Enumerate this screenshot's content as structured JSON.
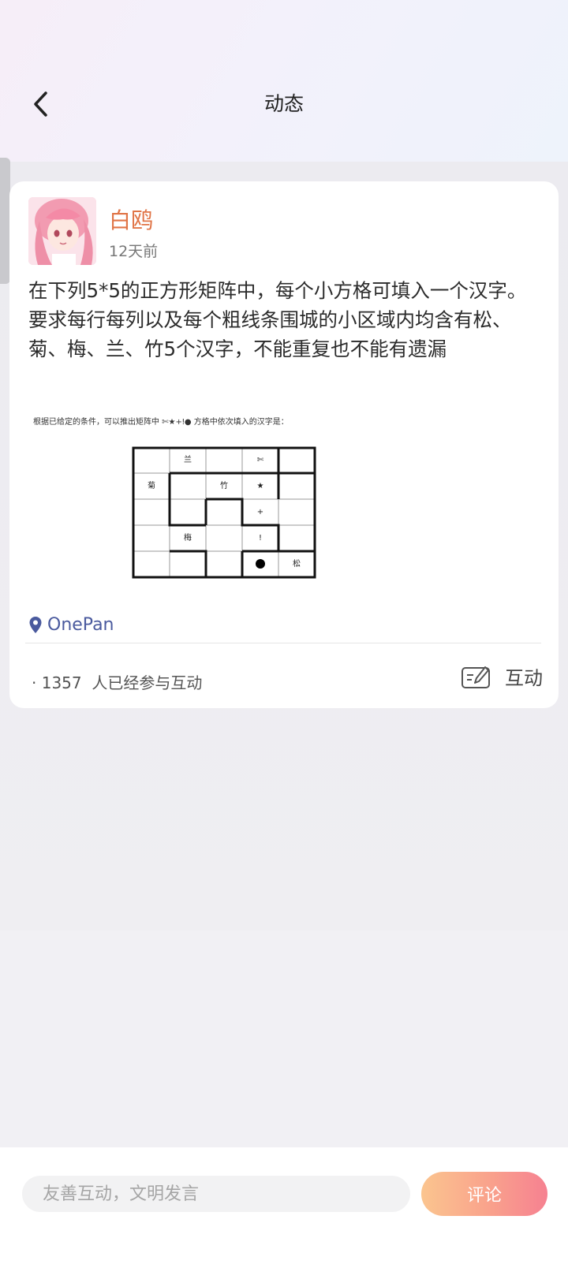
{
  "header": {
    "title": "动态"
  },
  "post": {
    "username": "白鸥",
    "time": "12天前",
    "text": "在下列5*5的正方形矩阵中，每个小方格可填入一个汉字。要求每行每列以及每个粗线条围城的小区域内均含有松、菊、梅、兰、竹5个汉字，不能重复也不能有遗漏",
    "image": {
      "caption": "根据已给定的条件，可以推出矩阵中",
      "caption_suffix": "方格中依次填入的汉字是：",
      "grid": [
        [
          "",
          "兰",
          "",
          "✄",
          ""
        ],
        [
          "菊",
          "",
          "竹",
          "★",
          ""
        ],
        [
          "",
          "",
          "",
          "+",
          ""
        ],
        [
          "",
          "梅",
          "",
          "ǃ",
          ""
        ],
        [
          "",
          "",
          "",
          "●",
          "松"
        ]
      ]
    },
    "location": "OnePan",
    "participants_count": "1357",
    "participants_label": "人已经参与互动",
    "interact_label": "互动"
  },
  "bottom": {
    "comment_placeholder": "友善互动，文明发言",
    "comment_button": "评论"
  }
}
